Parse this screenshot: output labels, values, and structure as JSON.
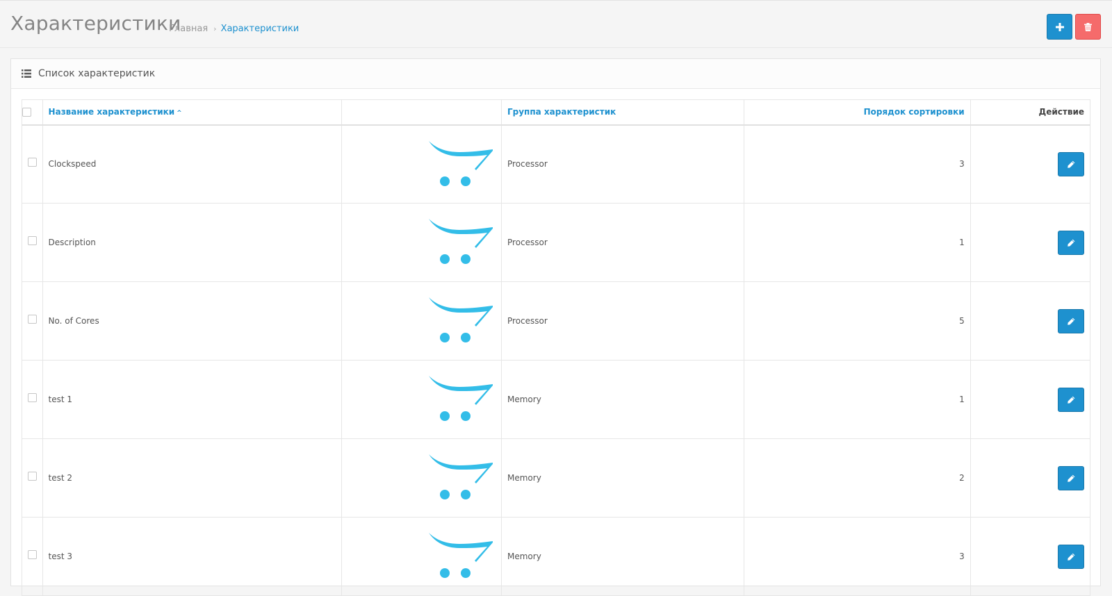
{
  "header": {
    "title": "Характеристики",
    "breadcrumb": {
      "home": "Главная",
      "separator": "›",
      "current": "Характеристики"
    },
    "add_icon": "plus-icon",
    "delete_icon": "trash-icon"
  },
  "panel": {
    "title": "Список характеристик",
    "icon": "list-icon"
  },
  "table": {
    "columns": {
      "name": "Название характеристики",
      "image": "",
      "group": "Группа характеристик",
      "sort_order": "Порядок сортировки",
      "action": "Действие"
    },
    "rows": [
      {
        "name": "Clockspeed",
        "group": "Processor",
        "sort_order": "3"
      },
      {
        "name": "Description",
        "group": "Processor",
        "sort_order": "1"
      },
      {
        "name": "No. of Cores",
        "group": "Processor",
        "sort_order": "5"
      },
      {
        "name": "test 1",
        "group": "Memory",
        "sort_order": "1"
      },
      {
        "name": "test 2",
        "group": "Memory",
        "sort_order": "2"
      },
      {
        "name": "test 3",
        "group": "Memory",
        "sort_order": "3"
      }
    ]
  },
  "colors": {
    "primary": "#1e91cf",
    "danger": "#f56b6b",
    "logo": "#33bde8"
  }
}
